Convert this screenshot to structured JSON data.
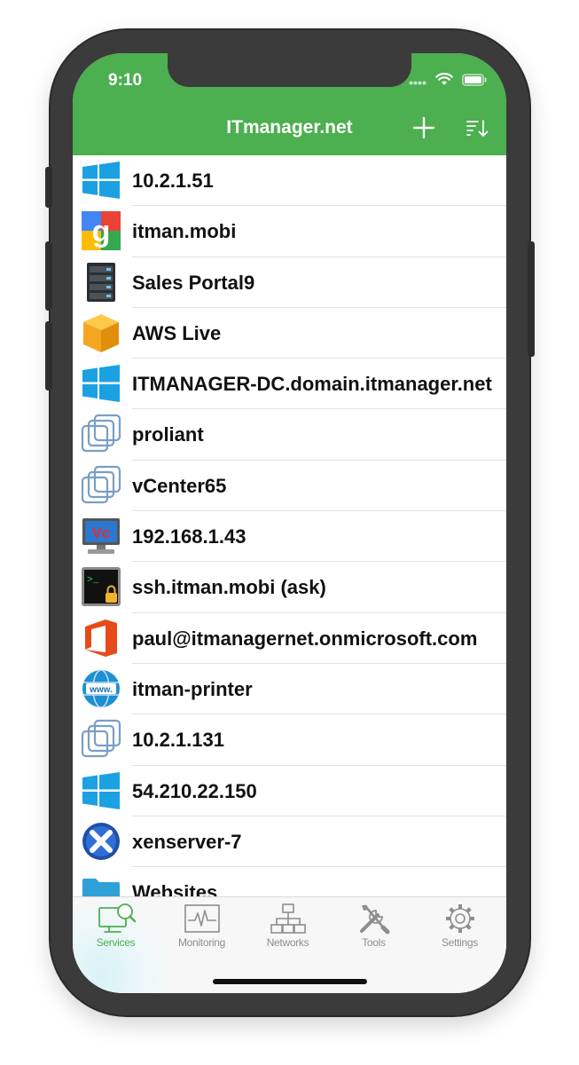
{
  "status": {
    "time": "9:10"
  },
  "nav": {
    "title": "ITmanager.net"
  },
  "list": [
    {
      "label": "10.2.1.51",
      "icon": "windows-icon"
    },
    {
      "label": "itman.mobi",
      "icon": "google-icon"
    },
    {
      "label": "Sales Portal9",
      "icon": "server-rack-icon"
    },
    {
      "label": "AWS Live",
      "icon": "aws-box-icon"
    },
    {
      "label": "ITMANAGER-DC.domain.itmanager.net",
      "icon": "windows-icon"
    },
    {
      "label": "proliant",
      "icon": "vmware-icon"
    },
    {
      "label": "vCenter65",
      "icon": "vmware-icon"
    },
    {
      "label": "192.168.1.43",
      "icon": "vnc-icon"
    },
    {
      "label": "ssh.itman.mobi (ask)",
      "icon": "ssh-terminal-icon"
    },
    {
      "label": "paul@itmanagernet.onmicrosoft.com",
      "icon": "office365-icon"
    },
    {
      "label": "itman-printer",
      "icon": "www-globe-icon"
    },
    {
      "label": "10.2.1.131",
      "icon": "vmware-icon"
    },
    {
      "label": "54.210.22.150",
      "icon": "windows-icon"
    },
    {
      "label": "xenserver-7",
      "icon": "xenserver-icon"
    },
    {
      "label": "Websites",
      "icon": "folder-icon"
    }
  ],
  "tabs": [
    {
      "label": "Services",
      "icon": "services-icon",
      "active": true
    },
    {
      "label": "Monitoring",
      "icon": "monitoring-icon",
      "active": false
    },
    {
      "label": "Networks",
      "icon": "networks-icon",
      "active": false
    },
    {
      "label": "Tools",
      "icon": "tools-icon",
      "active": false
    },
    {
      "label": "Settings",
      "icon": "settings-icon",
      "active": false
    }
  ],
  "colors": {
    "accent": "#4caf50",
    "tab_inactive": "#8e8e8e"
  }
}
